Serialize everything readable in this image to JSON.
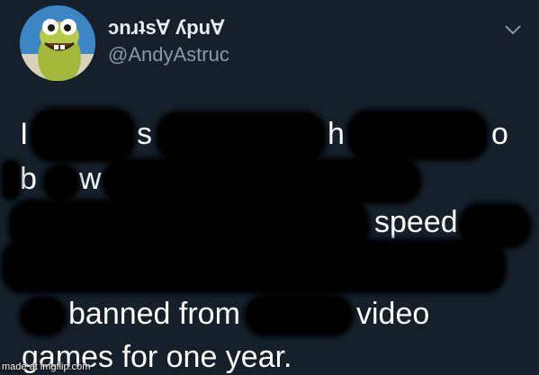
{
  "tweet": {
    "display_name": "ɔnɹʇs∀ ʎpu∀",
    "handle": "@AndyAstruc",
    "text_fragments": {
      "l1_a": "I",
      "l1_b": "s",
      "l1_c": "h",
      "l1_d": "o",
      "l2_a": "b",
      "l2_b": "w",
      "l3_a": "speed",
      "l5_a": "banned from",
      "l5_b": "video",
      "l6_a": "games for one year."
    }
  },
  "watermark": "made at imgflip.com",
  "icons": {
    "avatar": "cartoon-fish-avatar",
    "menu": "chevron-down-icon"
  },
  "colors": {
    "background": "#15202b",
    "text": "#ffffff",
    "handle": "#8899a6",
    "redaction": "#000000"
  }
}
